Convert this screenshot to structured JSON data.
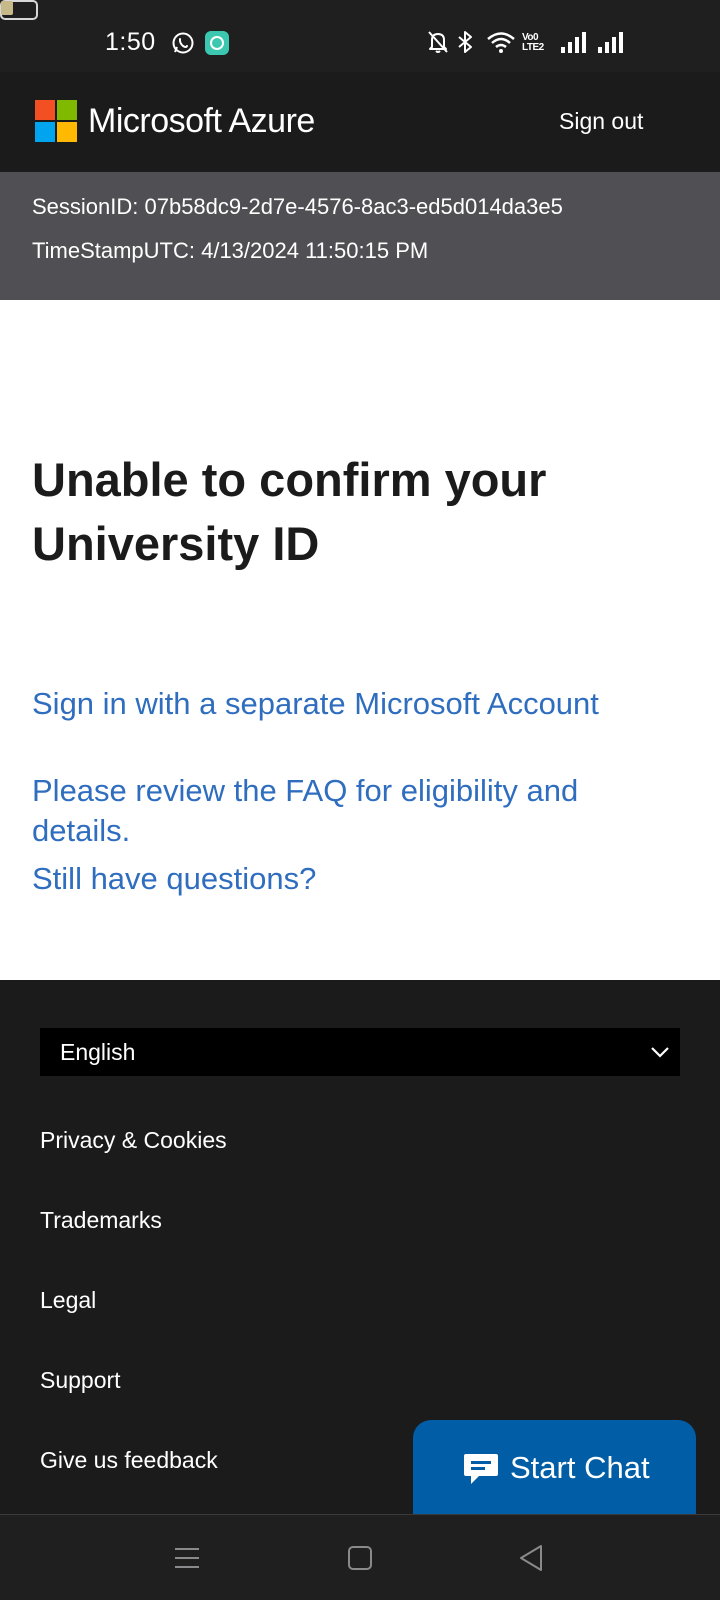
{
  "status_bar": {
    "time": "1:50",
    "icons": [
      "whatsapp-icon",
      "app-notification-icon",
      "mute-icon",
      "bluetooth-icon",
      "wifi-icon",
      "volte-icon",
      "signal-icon",
      "signal-icon",
      "battery-icon"
    ],
    "volte_top": "Vo0",
    "volte_bottom": "LTE2",
    "battery_level": "37"
  },
  "header": {
    "brand": "Microsoft Azure",
    "sign_out": "Sign out",
    "logo_colors": [
      "#f25022",
      "#7fba00",
      "#00a4ef",
      "#ffb900"
    ]
  },
  "session": {
    "session_id": "SessionID: 07b58dc9-2d7e-4576-8ac3-ed5d014da3e5",
    "timestamp": "TimeStampUTC: 4/13/2024 11:50:15 PM"
  },
  "main": {
    "title": "Unable to confirm your University ID",
    "links": {
      "sign_in": "Sign in with a separate Microsoft Account",
      "faq": "Please review the FAQ for eligibility and details.",
      "questions": "Still have questions?"
    },
    "link_color": "#2f6dbf"
  },
  "footer": {
    "language": "English",
    "links": {
      "privacy": "Privacy & Cookies",
      "trademarks": "Trademarks",
      "legal": "Legal",
      "support": "Support",
      "feedback": "Give us feedback"
    }
  },
  "chat": {
    "label": "Start Chat",
    "color": "#005da6"
  },
  "nav_bar": {
    "buttons": [
      "menu-icon",
      "home-icon",
      "back-icon"
    ]
  }
}
